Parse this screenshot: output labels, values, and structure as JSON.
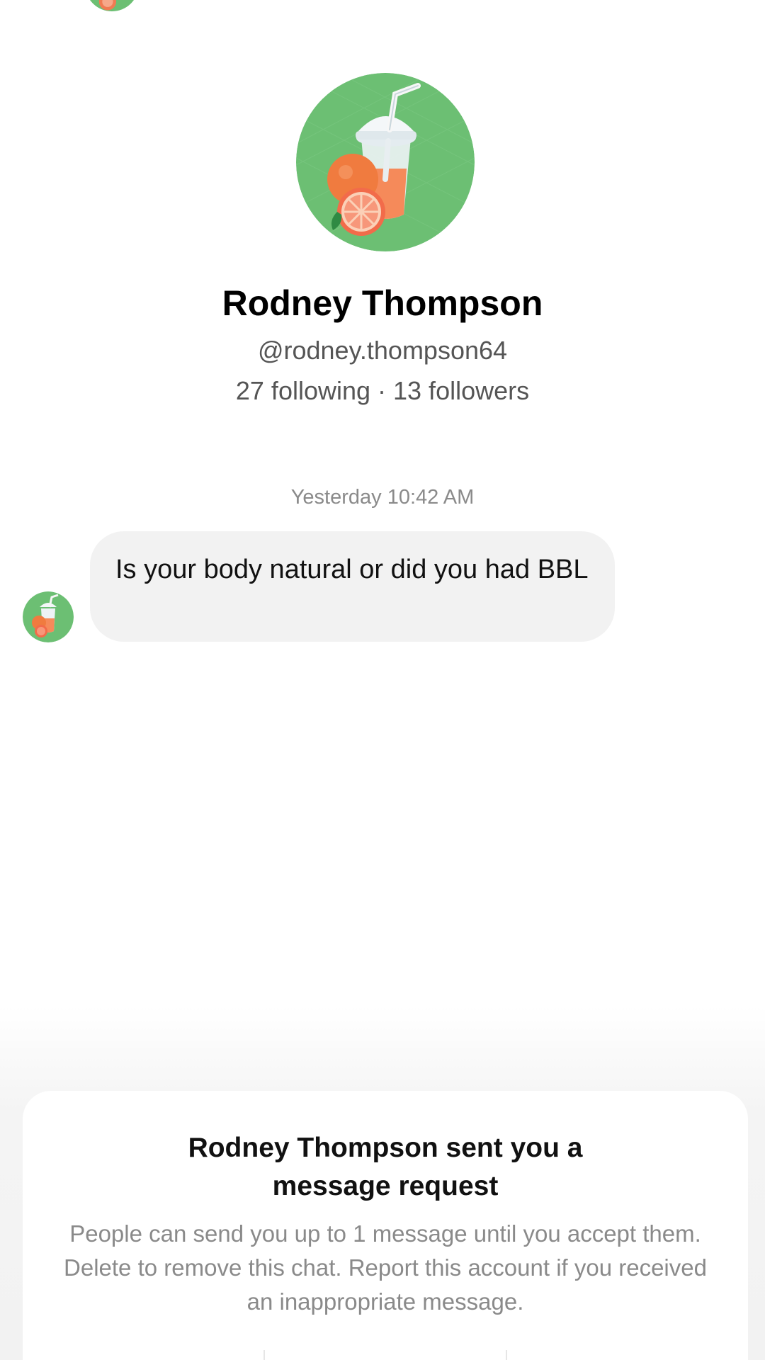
{
  "profile": {
    "name": "Rodney Thompson",
    "handle": "@rodney.thompson64",
    "following": "27 following",
    "separator": "·",
    "followers": "13 followers",
    "avatar_icon": "orange-juice-avatar-icon"
  },
  "chat": {
    "timestamp": "Yesterday 10:42 AM",
    "messages": [
      {
        "text": "Is your body natural or did you had BBL"
      }
    ]
  },
  "request_sheet": {
    "title_line1": "Rodney Thompson sent you a",
    "title_line2": "message request",
    "description": "People can send you up to 1 message until you accept them. Delete to remove this chat. Report this account if you received an inappropriate message."
  },
  "colors": {
    "avatar_bg": "#6cbf73",
    "bubble_bg": "#f2f2f2",
    "secondary_text": "#555555",
    "muted_text": "#8a8a8a"
  }
}
